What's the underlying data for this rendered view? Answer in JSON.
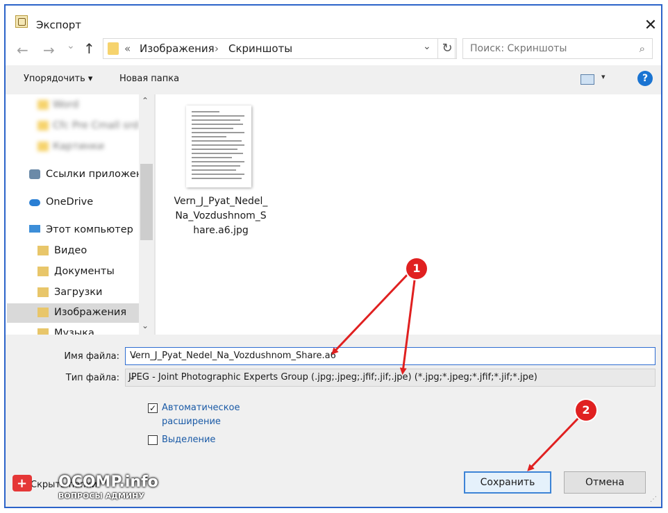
{
  "window": {
    "title": "Экспорт",
    "close": "✕"
  },
  "nav": {
    "back": "←",
    "forward": "→",
    "recent": "⌄",
    "up": "↑"
  },
  "address": {
    "sep": "«",
    "crumbs": [
      "Изображения",
      "Скриншоты"
    ],
    "arrow": "›",
    "dropdown": "⌄",
    "refresh": "↻"
  },
  "search": {
    "placeholder": "Поиск: Скриншоты",
    "icon": "⌕"
  },
  "toolbar": {
    "organize": "Упорядочить ▾",
    "new_folder": "Новая папка",
    "view_dd": "▾",
    "help": "?"
  },
  "sidebar": {
    "blurred": [
      "Word",
      "Cfc Pre Cmall srd",
      "Картинки"
    ],
    "items": [
      {
        "label": "Ссылки приложени",
        "icon": "links-icon"
      },
      {
        "label": "OneDrive",
        "icon": "cloud-icon"
      },
      {
        "label": "Этот компьютер",
        "icon": "computer-icon"
      },
      {
        "label": "Видео",
        "icon": "video-folder-icon"
      },
      {
        "label": "Документы",
        "icon": "documents-folder-icon"
      },
      {
        "label": "Загрузки",
        "icon": "downloads-folder-icon"
      },
      {
        "label": "Изображения",
        "icon": "pictures-folder-icon"
      },
      {
        "label": "Музыка",
        "icon": "music-folder-icon"
      }
    ],
    "scroll_up": "⌃",
    "scroll_down": "⌄"
  },
  "files": [
    {
      "name": "Vern_J_Pyat_Nedel_Na_Vozdushnom_Share.a6.jpg"
    }
  ],
  "form": {
    "filename_label": "Имя файла:",
    "filename_value": "Vern_J_Pyat_Nedel_Na_Vozdushnom_Share.a6",
    "filetype_label": "Тип файла:",
    "filetype_value": "JPEG - Joint Photographic Experts Group (.jpg;.jpeg;.jfif;.jif;.jpe) (*.jpg;*.jpeg;*.jfif;*.jif;*.jpe)",
    "dropdown": "⌄",
    "auto_ext_line1": "Автоматическое",
    "auto_ext_line2": "расширение",
    "auto_ext_checked": "✓",
    "selection": "Выделение",
    "hide_folders": "Скрыть папки",
    "save": "Сохранить",
    "cancel": "Отмена",
    "grip": "⋰"
  },
  "annotations": {
    "badge1": "1",
    "badge2": "2"
  },
  "watermark": {
    "text": "OCOMP.info",
    "sub": "ВОПРОСЫ АДМИНУ",
    "plus": "+"
  },
  "colors": {
    "accent": "#2b63c9",
    "arrow": "#e02020",
    "selected": "#d9d9d9",
    "link": "#1a5aa6"
  }
}
